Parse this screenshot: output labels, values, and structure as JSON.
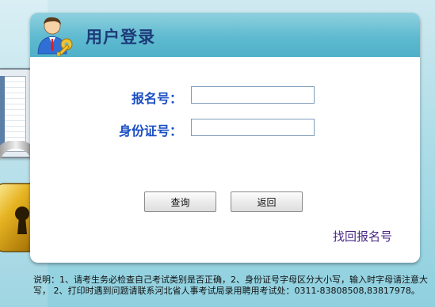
{
  "panel": {
    "title": "用户登录"
  },
  "form": {
    "reg_number_label": "报名号：",
    "reg_number_value": "",
    "id_card_label": "身份证号：",
    "id_card_value": ""
  },
  "buttons": {
    "query_label": "查询",
    "back_label": "返回"
  },
  "links": {
    "retrieve_reg_number": "找回报名号"
  },
  "notice": {
    "text": "说明：1、请考生务必检查自己考试类别是否正确，2、身份证号字母区分大小写，输入时字母请注意大写， 2、打印时遇到问题请联系河北省人事考试局录用聘用考试处：0311-83808508,83817978。"
  },
  "icons": {
    "header_icon": "user-with-key-icon",
    "decor_lock": "padlock-icon",
    "decor_screen": "monitor-icon"
  },
  "colors": {
    "header_gradient_top": "#8fd1df",
    "header_gradient_bottom": "#4fb0c8",
    "title": "#1e3a78",
    "label": "#1a4ec3",
    "link": "#4b2a86"
  }
}
